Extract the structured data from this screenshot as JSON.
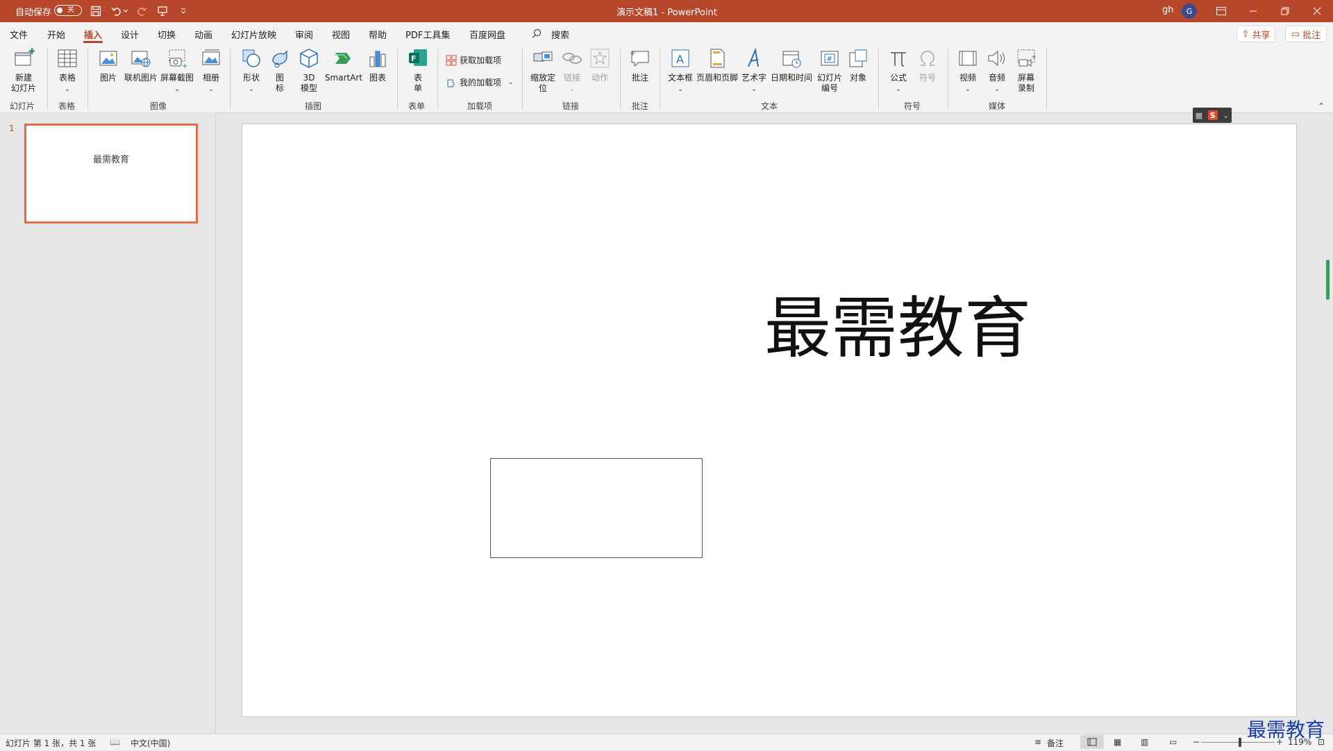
{
  "titlebar": {
    "autosave_label": "自动保存",
    "autosave_state": "关",
    "document_title": "演示文稿1  -  PowerPoint",
    "user_initials": "gh",
    "avatar_letter": "G"
  },
  "menu": {
    "tabs": [
      "文件",
      "开始",
      "插入",
      "设计",
      "切换",
      "动画",
      "幻灯片放映",
      "审阅",
      "视图",
      "帮助",
      "PDF工具集",
      "百度网盘"
    ],
    "active_tab": "插入",
    "search_label": "搜索",
    "share_label": "共享",
    "comment_label": "批注"
  },
  "ribbon": {
    "buttons": {
      "new_slide": "新建\n幻灯片",
      "table": "表格",
      "picture": "图片",
      "online_picture": "联机图片",
      "screenshot": "屏幕截图",
      "album": "相册",
      "shapes": "形状",
      "icons": "图\n标",
      "model3d": "3D\n模型",
      "smartart": "SmartArt",
      "chart": "图表",
      "forms": "表\n单",
      "get_addins": "获取加载项",
      "my_addins": "我的加载项",
      "zoom": "缩放定\n位",
      "link": "链接",
      "action": "动作",
      "comment": "批注",
      "textbox": "文本框",
      "header_footer": "页眉和页脚",
      "wordart": "艺术字",
      "datetime": "日期和时间",
      "slide_number": "幻灯片\n编号",
      "object": "对象",
      "equation": "公式",
      "symbol": "符号",
      "video": "视频",
      "audio": "音频",
      "screen_record": "屏幕\n录制"
    },
    "groups": {
      "slides": "幻灯片",
      "tables": "表格",
      "images": "图像",
      "illustrations": "插图",
      "forms": "表单",
      "addins": "加载项",
      "links": "链接",
      "comments": "批注",
      "text": "文本",
      "symbols": "符号",
      "media": "媒体"
    }
  },
  "thumbnails": [
    {
      "number": "1",
      "text": "最需教育"
    }
  ],
  "slide": {
    "title": "最需教育"
  },
  "statusbar": {
    "slide_info": "幻灯片 第 1 张，共 1 张",
    "language": "中文(中国)",
    "notes": "备注",
    "zoom": "119%",
    "zoom_level_percent": 119
  },
  "watermark": "最需教育"
}
